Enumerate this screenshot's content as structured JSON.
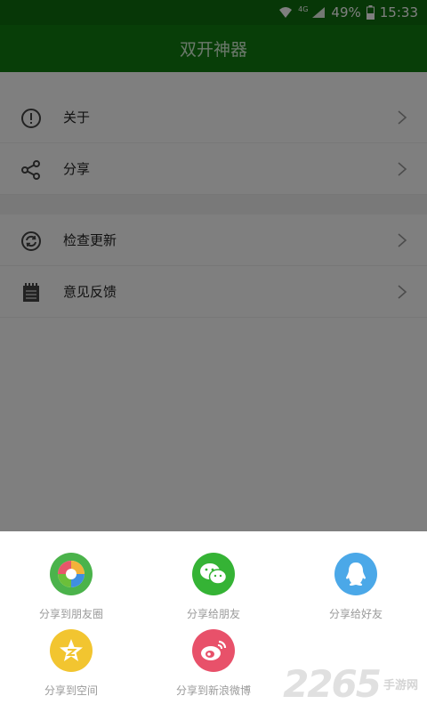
{
  "status_bar": {
    "network": "4G",
    "battery": "49%",
    "time": "15:33"
  },
  "app_bar": {
    "title": "双开神器"
  },
  "menu": {
    "group1": [
      {
        "label": "关于",
        "icon": "info-icon"
      },
      {
        "label": "分享",
        "icon": "share-icon"
      }
    ],
    "group2": [
      {
        "label": "检查更新",
        "icon": "refresh-icon"
      },
      {
        "label": "意见反馈",
        "icon": "notepad-icon"
      }
    ]
  },
  "share_sheet": {
    "items": [
      {
        "label": "分享到朋友圈",
        "icon": "wechat-moments-icon",
        "color": "#4bb34b"
      },
      {
        "label": "分享给朋友",
        "icon": "wechat-icon",
        "color": "#35b335"
      },
      {
        "label": "分享给好友",
        "icon": "qq-icon",
        "color": "#4ba8e8"
      },
      {
        "label": "分享到空间",
        "icon": "qzone-icon",
        "color": "#f2c530"
      },
      {
        "label": "分享到新浪微博",
        "icon": "weibo-icon",
        "color": "#e8516a"
      }
    ]
  },
  "watermark": {
    "number": "2265",
    "text": "手游网"
  }
}
